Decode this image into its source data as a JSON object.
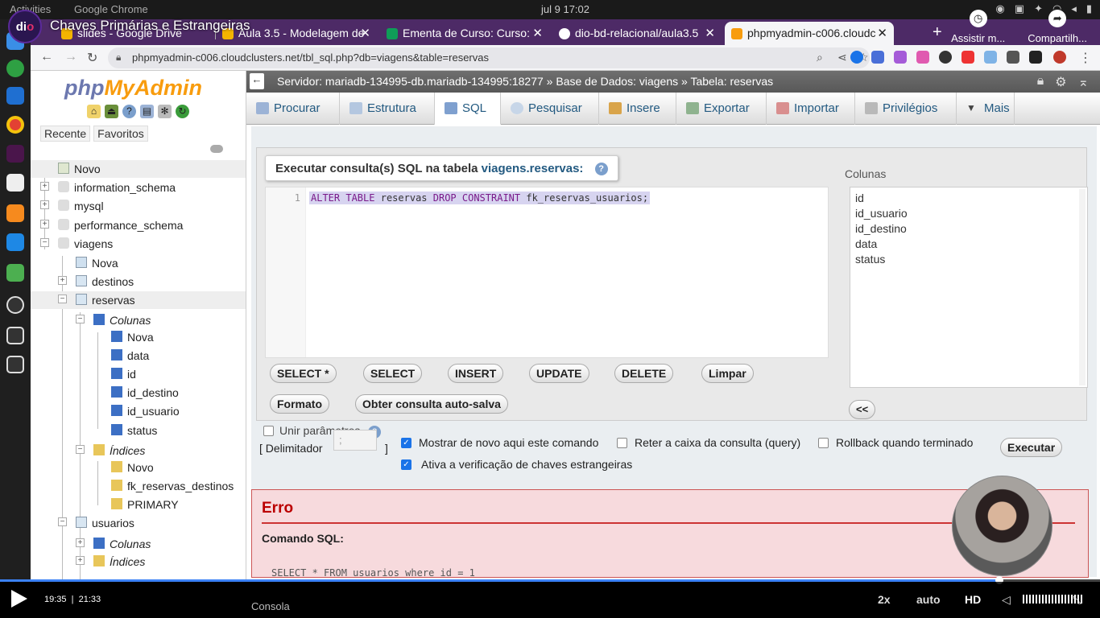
{
  "os": {
    "activities": "Activities",
    "app": "Google Chrome",
    "clock": "jul 9  17:02"
  },
  "video": {
    "title": "Chaves Primárias e Estrangeiras",
    "watch_later": "Assistir m...",
    "share": "Compartilh...",
    "time_current": "19:35",
    "time_total": "21:33",
    "speed": "2x",
    "quality": "auto",
    "hd": "HD"
  },
  "browser": {
    "tabs": [
      {
        "label": "slides - Google Drive"
      },
      {
        "label": "Aula 3.5 - Modelagem de"
      },
      {
        "label": "Ementa de Curso: Curso:"
      },
      {
        "label": "dio-bd-relacional/aula3.5"
      },
      {
        "label": "phpmyadmin-c006.cloudc"
      }
    ],
    "url": "phpmyadmin-c006.cloudclusters.net/tbl_sql.php?db=viagens&table=reservas"
  },
  "pma": {
    "logo_php": "php",
    "logo_my": "MyAdmin",
    "links": [
      "Recente",
      "Favoritos"
    ],
    "tree": {
      "novo": "Novo",
      "information_schema": "information_schema",
      "mysql": "mysql",
      "performance_schema": "performance_schema",
      "viagens": "viagens",
      "nova": "Nova",
      "destinos": "destinos",
      "reservas": "reservas",
      "colunas": "Colunas",
      "col_nova": "Nova",
      "col_data": "data",
      "col_id": "id",
      "col_id_destino": "id_destino",
      "col_id_usuario": "id_usuario",
      "col_status": "status",
      "indices": "Índices",
      "idx_novo": "Novo",
      "idx_fk": "fk_reservas_destinos",
      "idx_primary": "PRIMARY",
      "usuarios": "usuarios",
      "u_colunas": "Colunas",
      "u_indices": "Índices"
    },
    "breadcrumb": {
      "server": "Servidor: mariadb-134995-db.mariadb-134995:18277",
      "database": "Base de Dados: viagens",
      "table": "Tabela: reservas"
    },
    "menu": [
      "Procurar",
      "Estrutura",
      "SQL",
      "Pesquisar",
      "Insere",
      "Exportar",
      "Importar",
      "Privilégios",
      "Mais"
    ],
    "sql_head_prefix": "Executar consulta(s) SQL na tabela",
    "sql_head_table": "viagens.reservas:",
    "line_no": "1",
    "query_kw1": "ALTER TABLE",
    "query_t1": "reservas",
    "query_kw2": "DROP CONSTRAINT",
    "query_t2": "fk_reservas_usuarios;",
    "buttons": {
      "select_star": "SELECT *",
      "select": "SELECT",
      "insert": "INSERT",
      "update": "UPDATE",
      "delete": "DELETE",
      "limpar": "Limpar",
      "formato": "Formato",
      "autosave": "Obter consulta auto-salva",
      "insert_col": "<<",
      "executar": "Executar"
    },
    "columns_label": "Colunas",
    "columns": [
      "id",
      "id_usuario",
      "id_destino",
      "data",
      "status"
    ],
    "unir_parametros": "Unir parâmetros",
    "delim_label": "[ Delimitador",
    "delim_close": "]",
    "delim_value": ";",
    "opt_show_again": "Mostrar de novo aqui este comando",
    "opt_keep_box": "Reter a caixa da consulta (query)",
    "opt_rollback": "Rollback quando terminado",
    "opt_fk_check": "Ativa a verificação de chaves estrangeiras",
    "error_title": "Erro",
    "error_cmd": "Comando SQL:",
    "error_query": "SELECT * FROM usuarios where id = 1",
    "console": "Consola"
  },
  "colors": {
    "tabstrip": "#4d2a66",
    "link_blue": "#235a81",
    "progress": "#3b82f6",
    "error": "#b00000"
  }
}
